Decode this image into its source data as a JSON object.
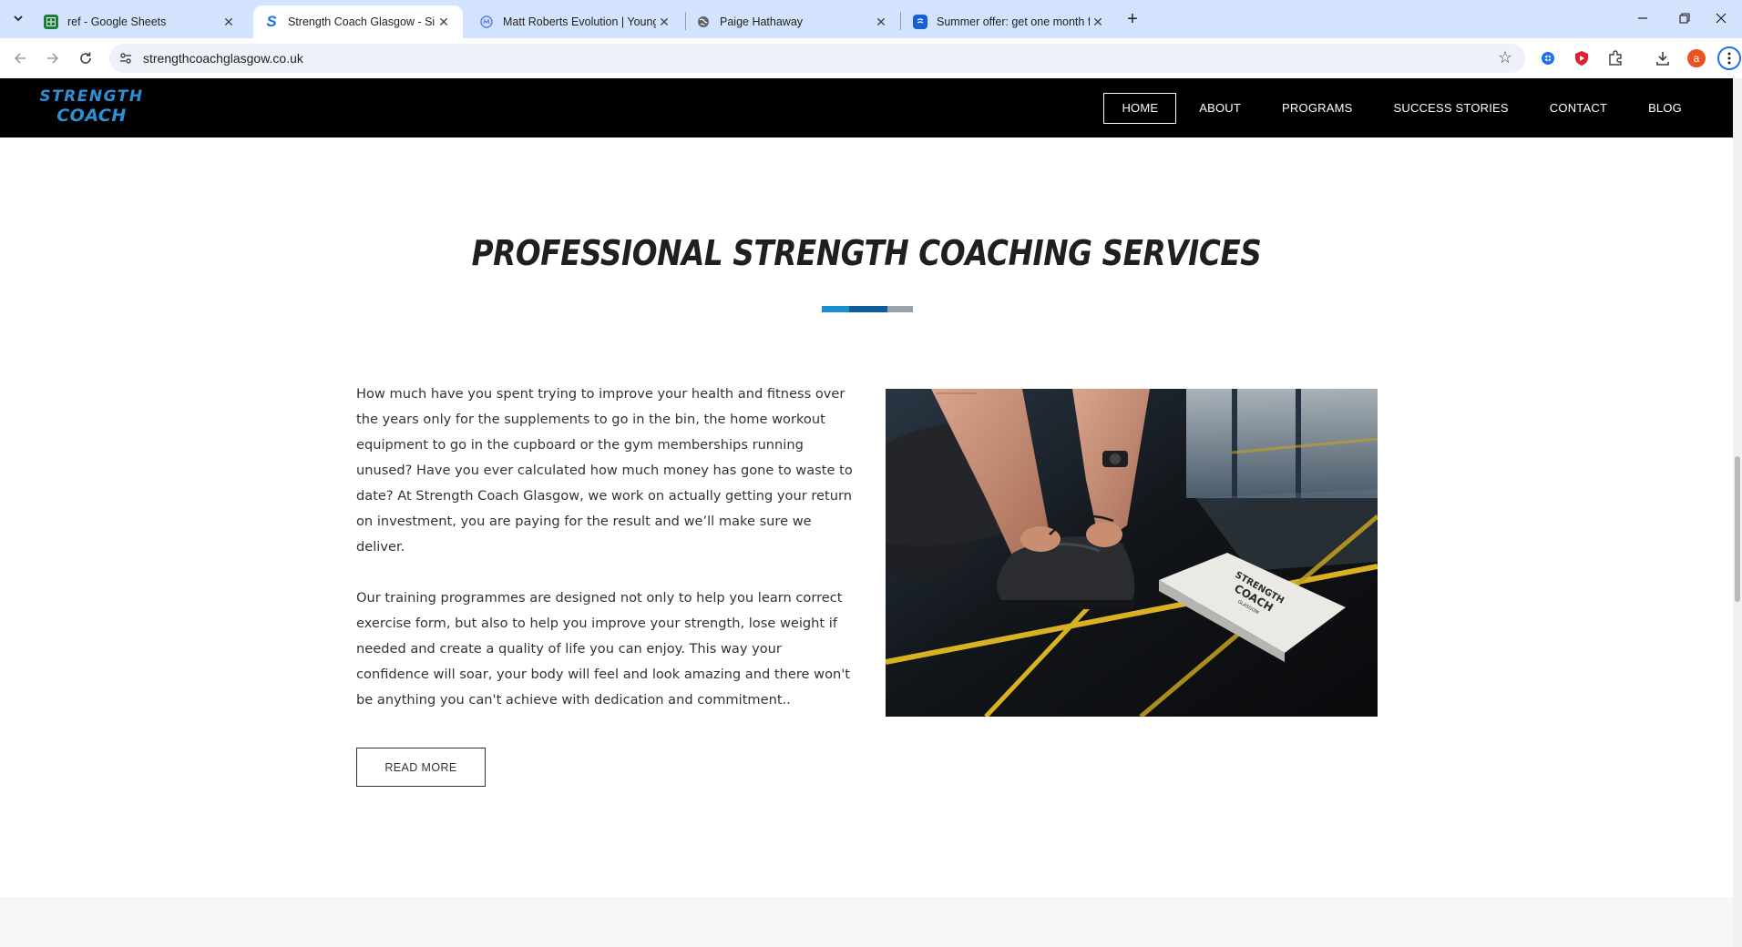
{
  "browser": {
    "tabs": [
      {
        "title": "ref - Google Sheets",
        "active": false,
        "favicon": "sheets-icon",
        "favicon_color": "#188038"
      },
      {
        "title": "Strength Coach Glasgow - Simp",
        "active": true,
        "favicon": "strength-coach-s-icon",
        "favicon_color": "#1a73e8"
      },
      {
        "title": "Matt Roberts Evolution | Young",
        "active": false,
        "favicon": "matt-roberts-icon",
        "favicon_color": "#5a7de0"
      },
      {
        "title": "Paige Hathaway",
        "active": false,
        "favicon": "globe-icon",
        "favicon_color": "#5f6368"
      },
      {
        "title": "Summer offer: get one month f",
        "active": false,
        "favicon": "offer-icon",
        "favicon_color": "#1a5fd1"
      }
    ],
    "url": "strengthcoachglasgow.co.uk",
    "profile_initial": "a",
    "profile_color": "#e8531f"
  },
  "site": {
    "logo": {
      "line1": "STRENGTH",
      "line2": "COACH",
      "color": "#2e8fd6"
    },
    "nav": [
      {
        "label": "HOME",
        "active": true
      },
      {
        "label": "ABOUT",
        "active": false
      },
      {
        "label": "PROGRAMS",
        "active": false
      },
      {
        "label": "SUCCESS STORIES",
        "active": false
      },
      {
        "label": "CONTACT",
        "active": false
      },
      {
        "label": "BLOG",
        "active": false
      }
    ]
  },
  "section": {
    "heading": "PROFESSIONAL STRENGTH COACHING SERVICES",
    "divider_colors": [
      "#1b8fd0",
      "#0f5e9c",
      "#9aa3ab"
    ],
    "paragraphs": [
      "How much have you spent trying to improve your health and fitness over the years only for the supplements to go in the bin, the home workout equipment to go in the cupboard or the gym memberships running unused? Have you ever calculated how much money has gone to waste to date? At Strength Coach Glasgow, we work on actually getting your return on investment, you are paying for the result and we’ll make sure we deliver.",
      "Our training programmes are designed not only to help you learn correct exercise form, but also to help you improve your strength, lose weight if needed and create a quality of life you can enjoy. This way your confidence will soar, your body will feel and look amazing and there won't be anything you can't achieve with dedication and commitment.."
    ],
    "read_more": "READ MORE",
    "image_bag_text": {
      "line1": "STRENGTH",
      "line2": "COACH",
      "line3": "GLASGOW"
    }
  }
}
